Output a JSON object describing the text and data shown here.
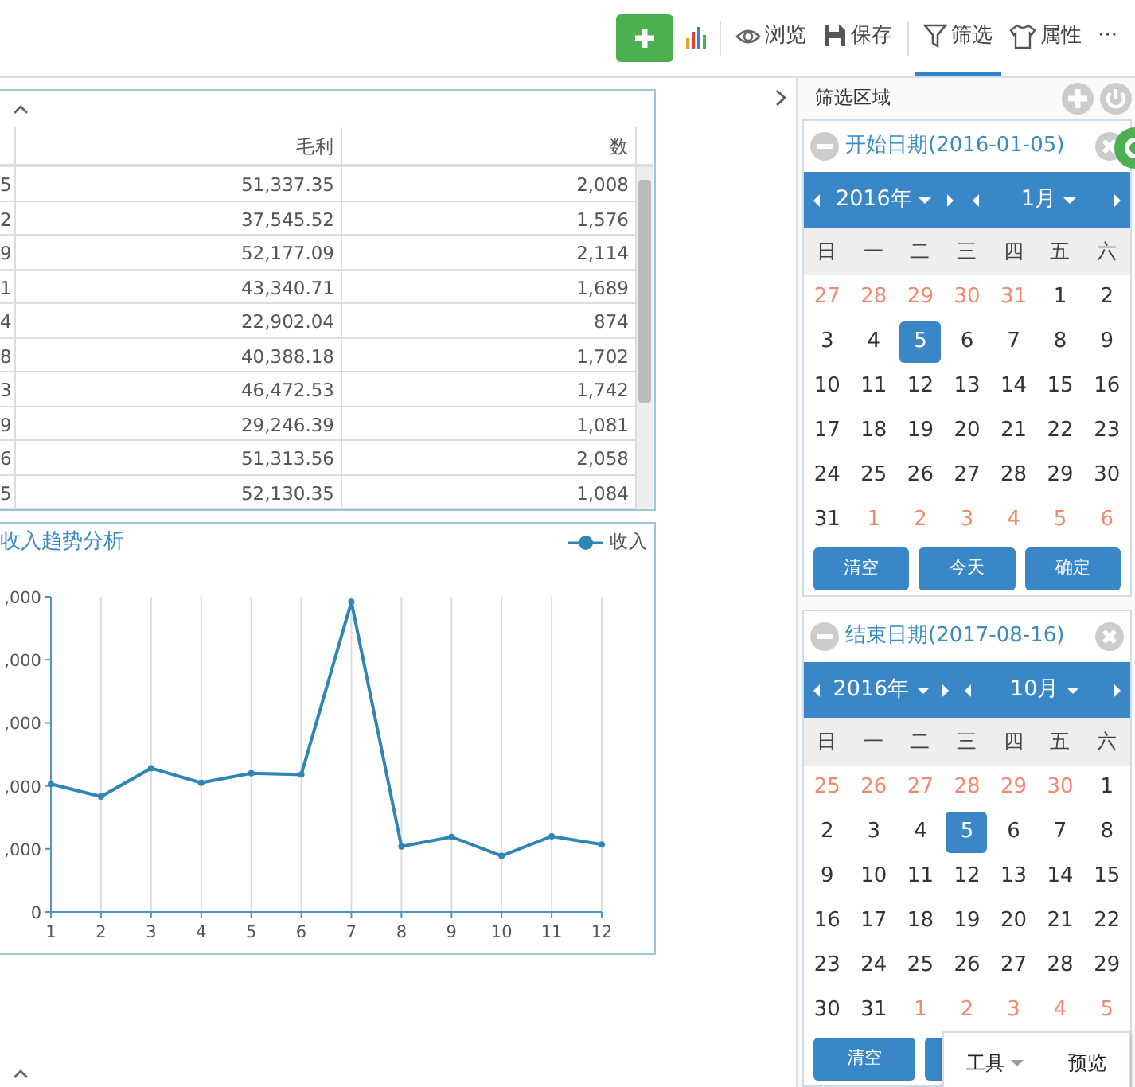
{
  "toolbar": {
    "items": [
      {
        "kind": "add"
      },
      {
        "kind": "chart"
      },
      {
        "kind": "view",
        "label": "浏览",
        "selected": false
      },
      {
        "kind": "save",
        "label": "保存",
        "selected": false
      },
      {
        "kind": "filter",
        "label": "筛选",
        "selected": true
      },
      {
        "kind": "props",
        "label": "属性",
        "selected": false
      },
      {
        "kind": "more",
        "label": "···",
        "selected": false
      }
    ]
  },
  "table": {
    "columns": [
      "",
      "毛利",
      "数"
    ],
    "rows": [
      {
        "cells": [
          "5",
          "51,337.35",
          "2,008"
        ]
      },
      {
        "cells": [
          "2",
          "37,545.52",
          "1,576"
        ]
      },
      {
        "cells": [
          "9",
          "52,177.09",
          "2,114"
        ]
      },
      {
        "cells": [
          "1",
          "43,340.71",
          "1,689"
        ]
      },
      {
        "cells": [
          "4",
          "22,902.04",
          "874"
        ]
      },
      {
        "cells": [
          "8",
          "40,388.18",
          "1,702"
        ]
      },
      {
        "cells": [
          "3",
          "46,472.53",
          "1,742"
        ]
      },
      {
        "cells": [
          "9",
          "29,246.39",
          "1,081"
        ]
      },
      {
        "cells": [
          "6",
          "51,313.56",
          "2,058"
        ]
      },
      {
        "cells": [
          "5",
          "52,130.35",
          "1,084"
        ]
      }
    ]
  },
  "chart": {
    "title": "收入趋势分析",
    "legend": "收入",
    "y_axis_labels": [
      ",000",
      ",000",
      ",000",
      ",000",
      ",000",
      "0"
    ],
    "x_axis_labels": [
      "1",
      "2",
      "3",
      "4",
      "5",
      "6",
      "7",
      "8",
      "9",
      "10",
      "11",
      "12"
    ]
  },
  "filter_panel": {
    "title": "筛选区域",
    "calendars": [
      {
        "title": "开始日期(2016-01-05)",
        "year": "2016年",
        "month": "1月",
        "weekdays": [
          "日",
          "一",
          "二",
          "三",
          "四",
          "五",
          "六"
        ],
        "days": [
          {
            "d": "27",
            "muted": true,
            "selected": false
          },
          {
            "d": "28",
            "muted": true,
            "selected": false
          },
          {
            "d": "29",
            "muted": true,
            "selected": false
          },
          {
            "d": "30",
            "muted": true,
            "selected": false
          },
          {
            "d": "31",
            "muted": true,
            "selected": false
          },
          {
            "d": "1",
            "muted": false,
            "selected": false
          },
          {
            "d": "2",
            "muted": false,
            "selected": false
          },
          {
            "d": "3",
            "muted": false,
            "selected": false
          },
          {
            "d": "4",
            "muted": false,
            "selected": false
          },
          {
            "d": "5",
            "muted": false,
            "selected": true
          },
          {
            "d": "6",
            "muted": false,
            "selected": false
          },
          {
            "d": "7",
            "muted": false,
            "selected": false
          },
          {
            "d": "8",
            "muted": false,
            "selected": false
          },
          {
            "d": "9",
            "muted": false,
            "selected": false
          },
          {
            "d": "10",
            "muted": false,
            "selected": false
          },
          {
            "d": "11",
            "muted": false,
            "selected": false
          },
          {
            "d": "12",
            "muted": false,
            "selected": false
          },
          {
            "d": "13",
            "muted": false,
            "selected": false
          },
          {
            "d": "14",
            "muted": false,
            "selected": false
          },
          {
            "d": "15",
            "muted": false,
            "selected": false
          },
          {
            "d": "16",
            "muted": false,
            "selected": false
          },
          {
            "d": "17",
            "muted": false,
            "selected": false
          },
          {
            "d": "18",
            "muted": false,
            "selected": false
          },
          {
            "d": "19",
            "muted": false,
            "selected": false
          },
          {
            "d": "20",
            "muted": false,
            "selected": false
          },
          {
            "d": "21",
            "muted": false,
            "selected": false
          },
          {
            "d": "22",
            "muted": false,
            "selected": false
          },
          {
            "d": "23",
            "muted": false,
            "selected": false
          },
          {
            "d": "24",
            "muted": false,
            "selected": false
          },
          {
            "d": "25",
            "muted": false,
            "selected": false
          },
          {
            "d": "26",
            "muted": false,
            "selected": false
          },
          {
            "d": "27",
            "muted": false,
            "selected": false
          },
          {
            "d": "28",
            "muted": false,
            "selected": false
          },
          {
            "d": "29",
            "muted": false,
            "selected": false
          },
          {
            "d": "30",
            "muted": false,
            "selected": false
          },
          {
            "d": "31",
            "muted": false,
            "selected": false
          },
          {
            "d": "1",
            "muted": true,
            "selected": false
          },
          {
            "d": "2",
            "muted": true,
            "selected": false
          },
          {
            "d": "3",
            "muted": true,
            "selected": false
          },
          {
            "d": "4",
            "muted": true,
            "selected": false
          },
          {
            "d": "5",
            "muted": true,
            "selected": false
          },
          {
            "d": "6",
            "muted": true,
            "selected": false
          }
        ],
        "buttons": [
          "清空",
          "今天",
          "确定"
        ]
      },
      {
        "title": "结束日期(2017-08-16)",
        "year": "2016年",
        "month": "10月",
        "weekdays": [
          "日",
          "一",
          "二",
          "三",
          "四",
          "五",
          "六"
        ],
        "days": [
          {
            "d": "25",
            "muted": true,
            "selected": false
          },
          {
            "d": "26",
            "muted": true,
            "selected": false
          },
          {
            "d": "27",
            "muted": true,
            "selected": false
          },
          {
            "d": "28",
            "muted": true,
            "selected": false
          },
          {
            "d": "29",
            "muted": true,
            "selected": false
          },
          {
            "d": "30",
            "muted": true,
            "selected": false
          },
          {
            "d": "1",
            "muted": false,
            "selected": false
          },
          {
            "d": "2",
            "muted": false,
            "selected": false
          },
          {
            "d": "3",
            "muted": false,
            "selected": false
          },
          {
            "d": "4",
            "muted": false,
            "selected": false
          },
          {
            "d": "5",
            "muted": false,
            "selected": true
          },
          {
            "d": "6",
            "muted": false,
            "selected": false
          },
          {
            "d": "7",
            "muted": false,
            "selected": false
          },
          {
            "d": "8",
            "muted": false,
            "selected": false
          },
          {
            "d": "9",
            "muted": false,
            "selected": false
          },
          {
            "d": "10",
            "muted": false,
            "selected": false
          },
          {
            "d": "11",
            "muted": false,
            "selected": false
          },
          {
            "d": "12",
            "muted": false,
            "selected": false
          },
          {
            "d": "13",
            "muted": false,
            "selected": false
          },
          {
            "d": "14",
            "muted": false,
            "selected": false
          },
          {
            "d": "15",
            "muted": false,
            "selected": false
          },
          {
            "d": "16",
            "muted": false,
            "selected": false
          },
          {
            "d": "17",
            "muted": false,
            "selected": false
          },
          {
            "d": "18",
            "muted": false,
            "selected": false
          },
          {
            "d": "19",
            "muted": false,
            "selected": false
          },
          {
            "d": "20",
            "muted": false,
            "selected": false
          },
          {
            "d": "21",
            "muted": false,
            "selected": false
          },
          {
            "d": "22",
            "muted": false,
            "selected": false
          },
          {
            "d": "23",
            "muted": false,
            "selected": false
          },
          {
            "d": "24",
            "muted": false,
            "selected": false
          },
          {
            "d": "25",
            "muted": false,
            "selected": false
          },
          {
            "d": "26",
            "muted": false,
            "selected": false
          },
          {
            "d": "27",
            "muted": false,
            "selected": false
          },
          {
            "d": "28",
            "muted": false,
            "selected": false
          },
          {
            "d": "29",
            "muted": false,
            "selected": false
          },
          {
            "d": "30",
            "muted": false,
            "selected": false
          },
          {
            "d": "31",
            "muted": false,
            "selected": false
          },
          {
            "d": "1",
            "muted": true,
            "selected": false
          },
          {
            "d": "2",
            "muted": true,
            "selected": false
          },
          {
            "d": "3",
            "muted": true,
            "selected": false
          },
          {
            "d": "4",
            "muted": true,
            "selected": false
          },
          {
            "d": "5",
            "muted": true,
            "selected": false
          }
        ],
        "buttons": [
          "清空"
        ]
      }
    ]
  },
  "popup_menu": {
    "tools": "工具",
    "preview": "预览"
  }
}
